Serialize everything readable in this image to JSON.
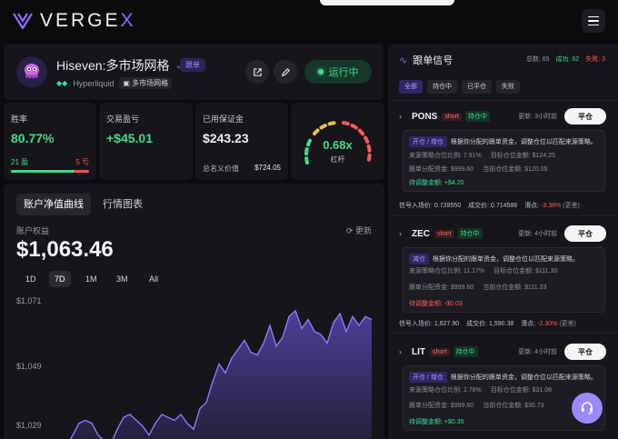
{
  "brand": {
    "name_main": "VERGE",
    "name_accent": "X"
  },
  "strategy": {
    "name": "Hiseven:多市场网格",
    "follow_badge": "跟单",
    "exchange": "Hyperliquid",
    "type_tag": "多市场网格",
    "status_label": "运行中"
  },
  "stats": {
    "winrate": {
      "label": "胜率",
      "value": "80.77%",
      "wins": "21 盈",
      "losses": "5 亏",
      "win_fraction": 0.8077
    },
    "pnl": {
      "label": "交易盈亏",
      "value": "+$45.01"
    },
    "margin": {
      "label": "已用保证金",
      "value": "$243.23",
      "notional_label": "总名义价值",
      "notional_value": "$724.05"
    },
    "leverage": {
      "value": "0.68x",
      "label": "杠杆"
    }
  },
  "equity": {
    "tabs": [
      "账户净值曲线",
      "行情图表"
    ],
    "account_label": "账户权益",
    "refresh_label": "更新",
    "balance": "$1,063.46",
    "ranges": [
      "1D",
      "7D",
      "1M",
      "3M",
      "All"
    ],
    "active_range": "7D",
    "y_ticks": [
      "$1,071",
      "$1,049",
      "$1,029"
    ]
  },
  "chart_data": {
    "type": "area",
    "title": "",
    "xlabel": "",
    "ylabel": "",
    "y_ticks": [
      1071,
      1049,
      1029
    ],
    "series": [
      {
        "values": [
          1021,
          1022,
          1026,
          1030,
          1031,
          1030,
          1026,
          1024,
          1023,
          1028,
          1032,
          1033,
          1031,
          1029,
          1026,
          1030,
          1033,
          1032,
          1031,
          1033,
          1030,
          1028,
          1035,
          1037,
          1044,
          1050,
          1047,
          1052,
          1055,
          1058,
          1054,
          1053,
          1057,
          1063,
          1056,
          1059,
          1066,
          1068,
          1062,
          1065,
          1061,
          1060,
          1057,
          1064,
          1067,
          1061,
          1066,
          1063,
          1066,
          1065
        ]
      }
    ],
    "color": "#7b61ff"
  },
  "signals": {
    "title": "跟单信号",
    "total": "总数: 65",
    "success": "成功: 62",
    "fail": "失败: 3",
    "filters": [
      "全部",
      "持仓中",
      "已平仓",
      "失败"
    ],
    "items": [
      {
        "symbol": "PONS",
        "side": "short",
        "status": "持仓中",
        "time": "更新: 3小时前",
        "close_label": "平仓",
        "action_tag": "开仓 / 增仓",
        "action_text": "根据你分配的跟单资金，调整仓位以匹配来源策略。",
        "src_ratio": "来源策略仓位比例: 7.91%",
        "target_amt": "目标仓位金额: $124.25",
        "alloc": "跟单分配资金: $999.60",
        "current_amt": "当前仓位金额: $120.05",
        "pending": "待调整金额: +$4.20",
        "pending_neg": false,
        "entry": "信号入场价: 0.739550",
        "fill": "成交价: 0.714586",
        "slip_label": "滑点:",
        "slip": "-3.38%",
        "slip_note": "(更差)"
      },
      {
        "symbol": "ZEC",
        "side": "short",
        "status": "持仓中",
        "time": "更新: 4小时前",
        "close_label": "平仓",
        "action_tag": "减仓",
        "action_text": "根据你分配的跟单资金，调整仓位以匹配来源策略。",
        "src_ratio": "来源策略仓位比例: 11.17%",
        "target_amt": "目标仓位金额: $111.30",
        "alloc": "跟单分配资金: $999.60",
        "current_amt": "当前仓位金额: $111.33",
        "pending": "待调整金额: -$0.03",
        "pending_neg": true,
        "entry": "信号入场价: 1,627.90",
        "fill": "成交价: 1,590.38",
        "slip_label": "滑点:",
        "slip": "-2.30%",
        "slip_note": "(更差)"
      },
      {
        "symbol": "LIT",
        "side": "short",
        "status": "持仓中",
        "time": "更新: 4小时前",
        "close_label": "平仓",
        "action_tag": "开仓 / 增仓",
        "action_text": "根据你分配的跟单资金，调整仓位以匹配来源策略。",
        "src_ratio": "来源策略仓位比例: 2.78%",
        "target_amt": "目标仓位金额: $31.08",
        "alloc": "跟单分配资金: $999.60",
        "current_amt": "当前仓位金额: $30.73",
        "pending": "待调整金额: +$0.35",
        "pending_neg": false
      }
    ]
  }
}
